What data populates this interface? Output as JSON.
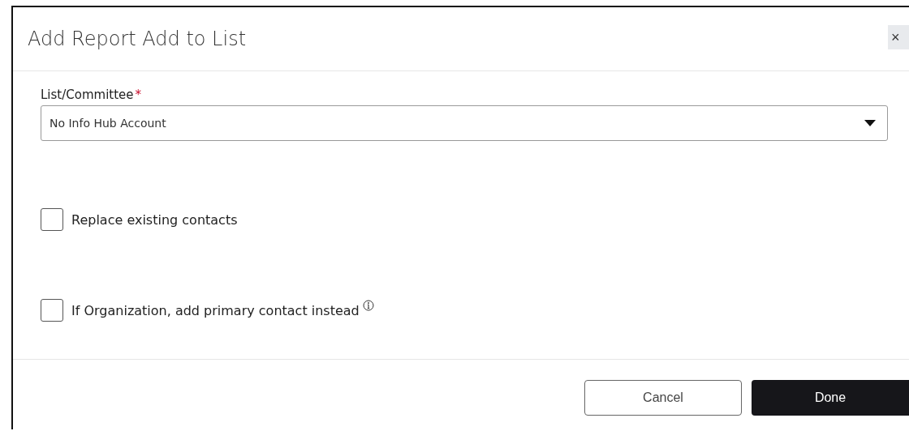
{
  "dialog": {
    "title": "Add Report Add to List",
    "close": "×"
  },
  "field": {
    "label": "List/Committee",
    "required_mark": "*",
    "value": "No Info Hub Account"
  },
  "options": [
    {
      "label": "Replace existing contacts",
      "checked": false,
      "info": false
    },
    {
      "label": "If Organization, add primary contact instead",
      "checked": false,
      "info": true
    }
  ],
  "buttons": [
    {
      "label": "Cancel",
      "kind": "secondary"
    },
    {
      "label": "Done",
      "kind": "primary"
    }
  ]
}
